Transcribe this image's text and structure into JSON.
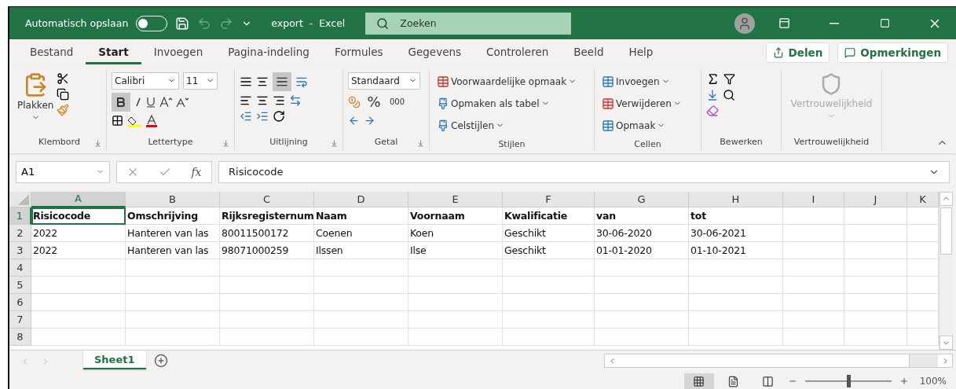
{
  "title_bar": {
    "autosave_label": "Automatisch opslaan",
    "autosave_on": false,
    "file_title": "export  -  Excel",
    "search_placeholder": "Zoeken"
  },
  "menu_tabs": [
    {
      "label": "Bestand",
      "selected": false
    },
    {
      "label": "Start",
      "selected": true
    },
    {
      "label": "Invoegen",
      "selected": false
    },
    {
      "label": "Pagina-indeling",
      "selected": false
    },
    {
      "label": "Formules",
      "selected": false
    },
    {
      "label": "Gegevens",
      "selected": false
    },
    {
      "label": "Controleren",
      "selected": false
    },
    {
      "label": "Beeld",
      "selected": false
    },
    {
      "label": "Help",
      "selected": false
    }
  ],
  "share_button": "Delen",
  "comments_button": "Opmerkingen",
  "ribbon": {
    "clipboard": {
      "paste": "Plakken",
      "group": "Klembord"
    },
    "font": {
      "name": "Calibri",
      "size": "11",
      "bold_active": true,
      "group": "Lettertype"
    },
    "alignment": {
      "bottom_align_active": true,
      "group": "Uitlijning"
    },
    "number": {
      "format": "Standaard",
      "percent": "%",
      "thousands": "000",
      "group": "Getal"
    },
    "styles": {
      "items": [
        "Voorwaardelijke opmaak",
        "Opmaken als tabel",
        "Celstijlen"
      ],
      "group": "Stijlen"
    },
    "cells": {
      "items": [
        "Invoegen",
        "Verwijderen",
        "Opmaak"
      ],
      "group": "Cellen"
    },
    "editing": {
      "group": "Bewerken"
    },
    "sensitivity": {
      "label": "Vertrouwelijkheid",
      "disabled": true,
      "group": "Vertrouwelijkheid"
    }
  },
  "formula_bar": {
    "name_box": "A1",
    "function_label": "fx",
    "value": "Risicocode"
  },
  "sheet": {
    "columns": [
      {
        "label": "A",
        "selected": true
      },
      {
        "label": "B",
        "selected": false
      },
      {
        "label": "C",
        "selected": false
      },
      {
        "label": "D",
        "selected": false
      },
      {
        "label": "E",
        "selected": false
      },
      {
        "label": "F",
        "selected": false
      },
      {
        "label": "G",
        "selected": false
      },
      {
        "label": "H",
        "selected": false
      },
      {
        "label": "I",
        "selected": false
      },
      {
        "label": "J",
        "selected": false
      },
      {
        "label": "K",
        "selected": false
      }
    ],
    "rows": [
      {
        "number": "1",
        "selected": true,
        "bold": true,
        "cells": [
          "Risicocode",
          "Omschrijving",
          "Rijksregisternum",
          "Naam",
          "Voornaam",
          "Kwalificatie",
          "van",
          "tot"
        ]
      },
      {
        "number": "2",
        "selected": false,
        "bold": false,
        "cells": [
          "2022",
          "Hanteren van las",
          "80011500172",
          "Coenen",
          "Koen",
          "Geschikt",
          "30-06-2020",
          "30-06-2021"
        ]
      },
      {
        "number": "3",
        "selected": false,
        "bold": false,
        "cells": [
          "2022",
          "Hanteren van las",
          "98071000259",
          "Ilssen",
          "Ilse",
          "Geschikt",
          "01-01-2020",
          "01-10-2021"
        ]
      },
      {
        "number": "4",
        "selected": false
      },
      {
        "number": "5",
        "selected": false
      },
      {
        "number": "6",
        "selected": false
      },
      {
        "number": "7",
        "selected": false
      },
      {
        "number": "8",
        "selected": false
      }
    ]
  },
  "sheet_tabs": [
    {
      "label": "Sheet1",
      "selected": true
    }
  ],
  "status_bar": {
    "views": [
      {
        "kind": "normal",
        "selected": true
      },
      {
        "kind": "page_layout",
        "selected": false
      },
      {
        "kind": "page_break",
        "selected": false
      }
    ],
    "level": 0.5,
    "zoom": "100%"
  }
}
